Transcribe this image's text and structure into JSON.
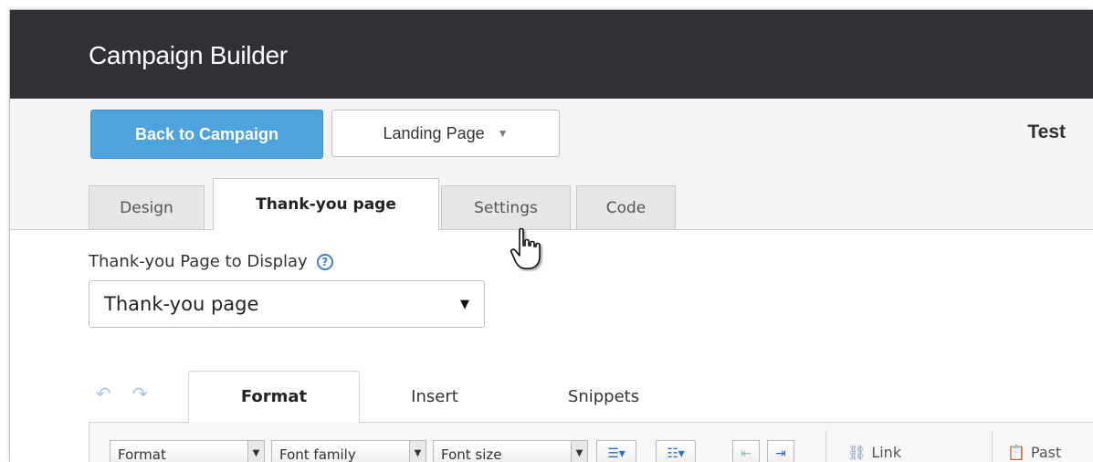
{
  "header": {
    "title": "Campaign Builder"
  },
  "toolbar": {
    "back_label": "Back to Campaign",
    "page_select": "Landing Page",
    "test_label": "Test"
  },
  "tabs": [
    {
      "label": "Design"
    },
    {
      "label": "Thank-you page",
      "active": true
    },
    {
      "label": "Settings"
    },
    {
      "label": "Code"
    }
  ],
  "thankyou": {
    "label": "Thank-you Page to Display",
    "selected": "Thank-you page"
  },
  "editor": {
    "tabs": [
      {
        "label": "Format",
        "active": true
      },
      {
        "label": "Insert"
      },
      {
        "label": "Snippets"
      }
    ],
    "format_select": "Format",
    "font_family_select": "Font family",
    "font_size_select": "Font size",
    "link_label": "Link",
    "paste_label": "Past"
  }
}
